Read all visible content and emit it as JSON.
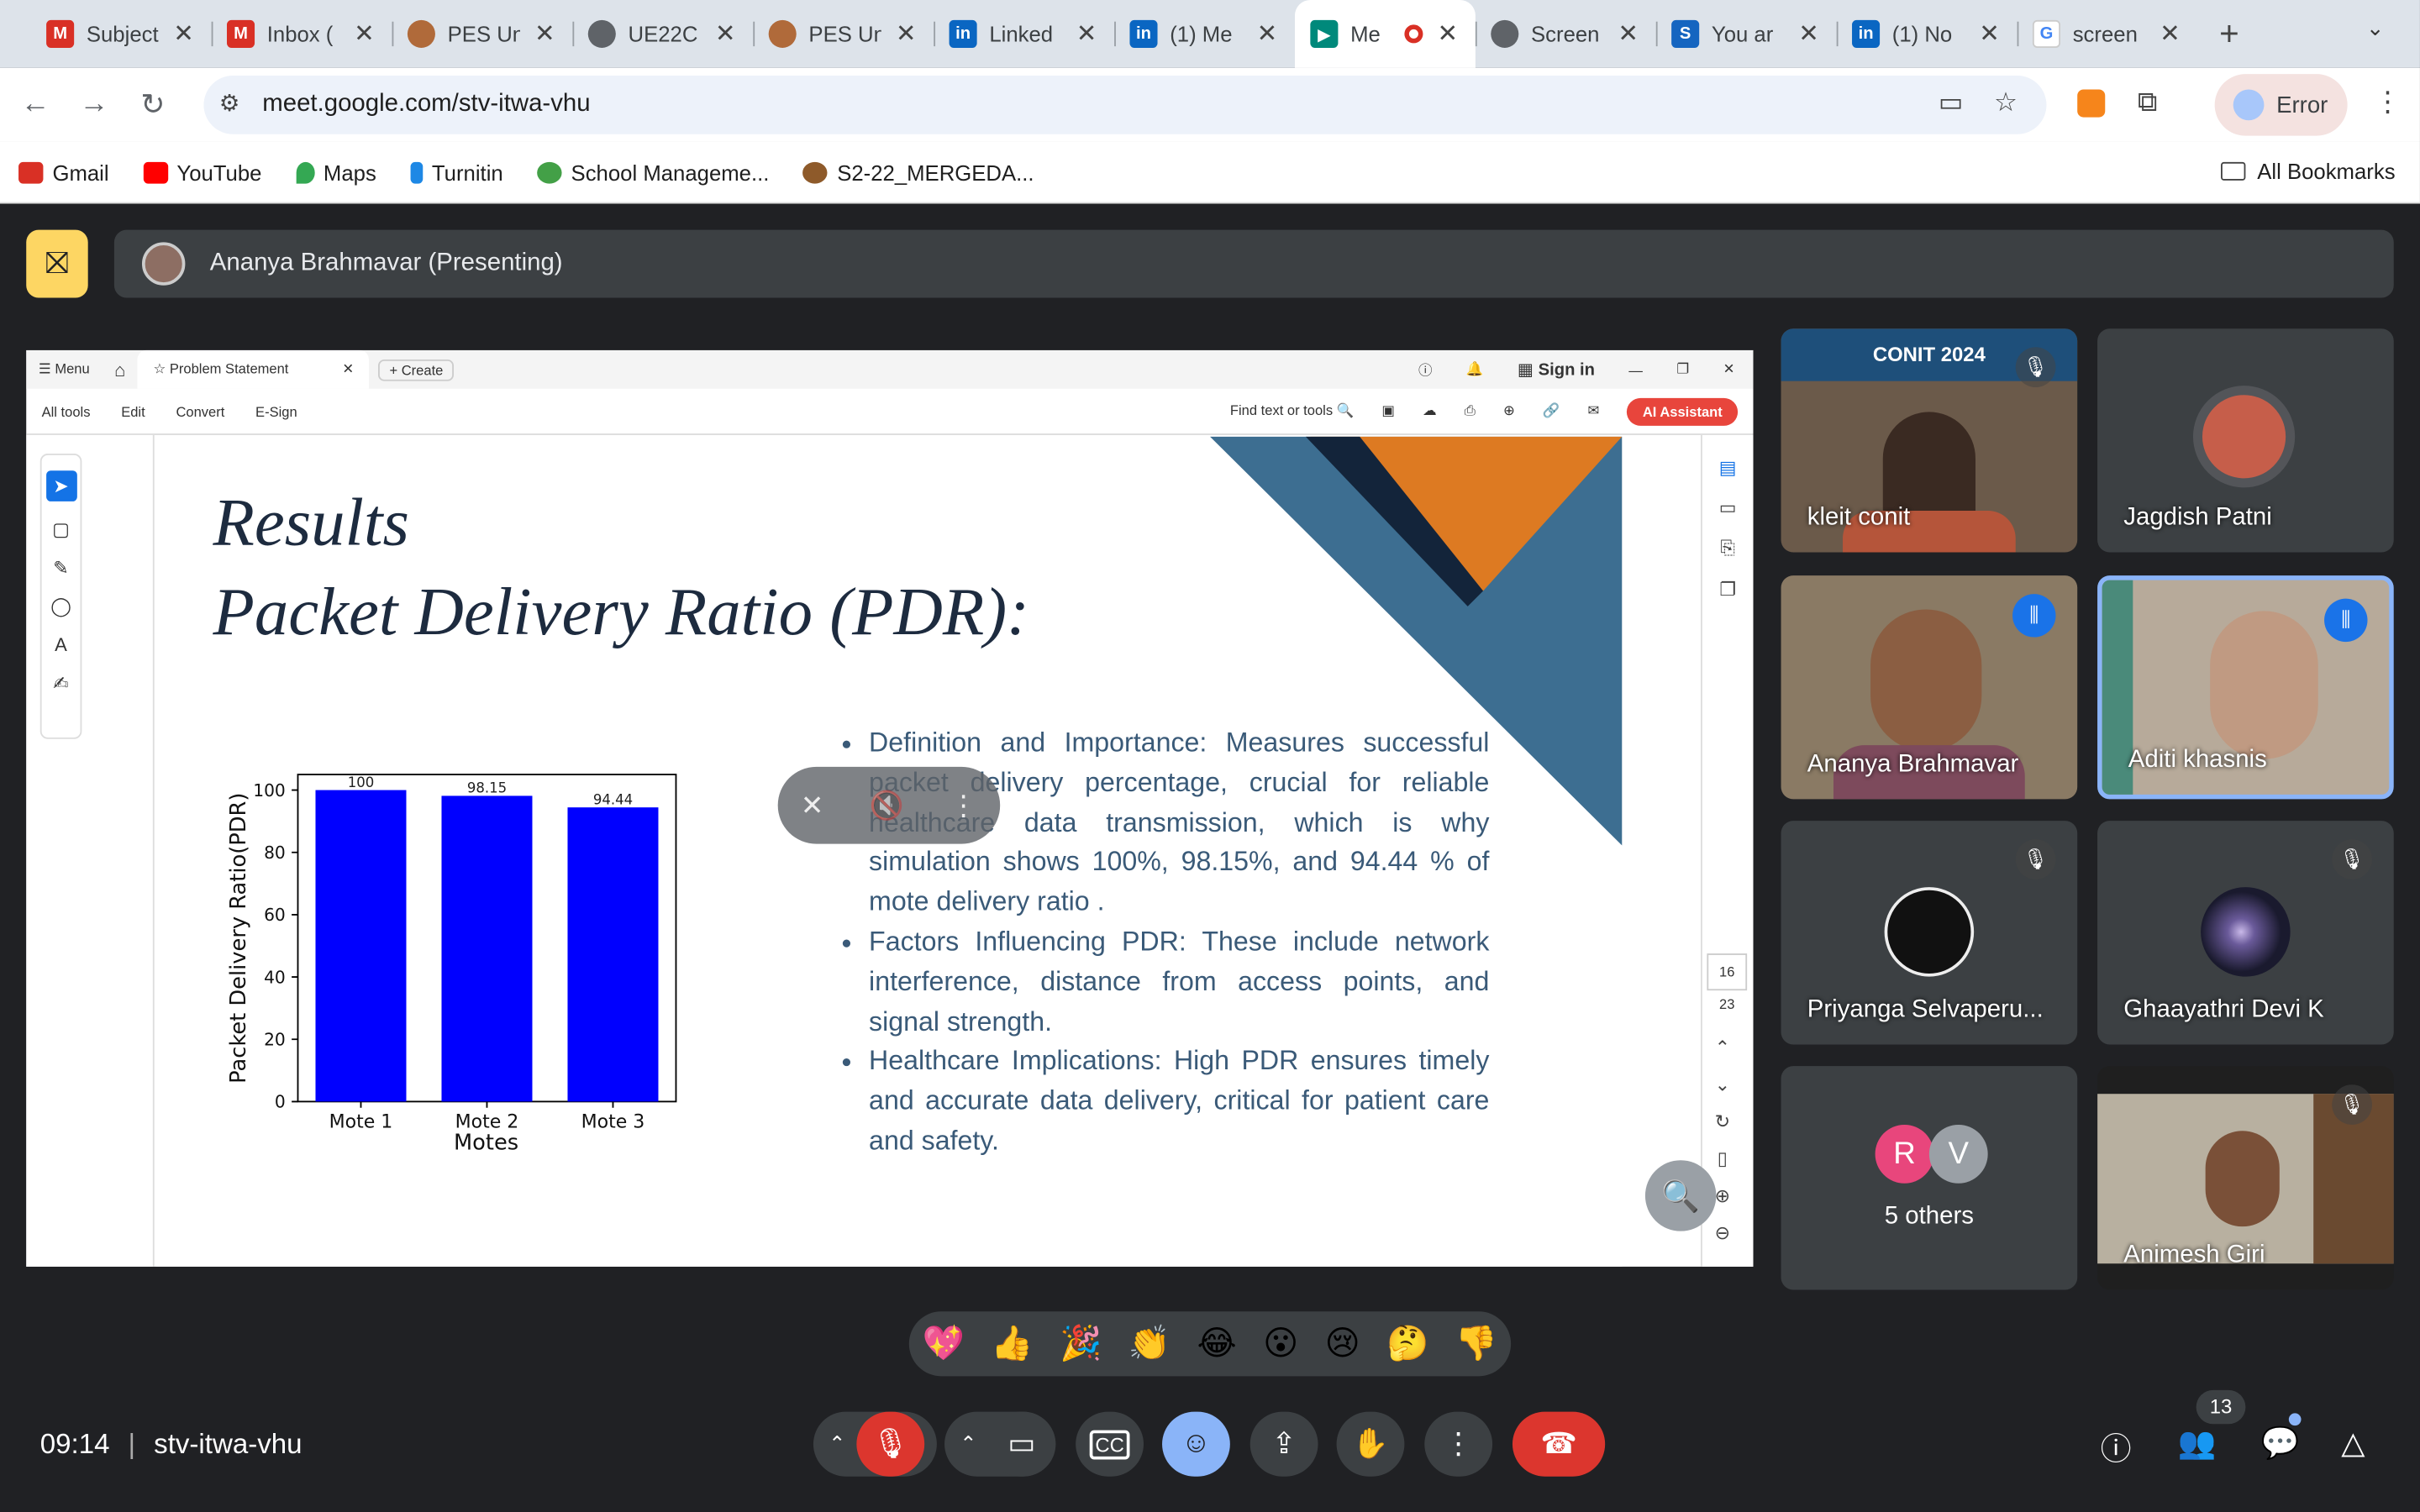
{
  "browser": {
    "tabs": [
      {
        "title": "Subject",
        "favicon": "gmail-icon",
        "color": "#d93025"
      },
      {
        "title": "Inbox (",
        "favicon": "gmail-icon",
        "color": "#d93025"
      },
      {
        "title": "PES Un",
        "favicon": "pes-icon",
        "color": "#b06a3a"
      },
      {
        "title": "UE22C",
        "favicon": "globe-icon",
        "color": "#5f6368"
      },
      {
        "title": "PES Un",
        "favicon": "pes-icon",
        "color": "#b06a3a"
      },
      {
        "title": "Linked",
        "favicon": "linkedin-icon",
        "color": "#0a66c2"
      },
      {
        "title": "(1) Me",
        "favicon": "linkedin-icon",
        "color": "#0a66c2"
      },
      {
        "title": "Me",
        "favicon": "meet-icon",
        "color": "#00897b",
        "active": true
      },
      {
        "title": "Screen",
        "favicon": "globe-icon",
        "color": "#5f6368"
      },
      {
        "title": "You ar",
        "favicon": "s-icon",
        "color": "#1565c0"
      },
      {
        "title": "(1) No",
        "favicon": "linkedin-icon",
        "color": "#0a66c2"
      },
      {
        "title": "screen",
        "favicon": "google-icon",
        "color": "#4285f4"
      }
    ],
    "url": "meet.google.com/stv-itwa-vhu",
    "profile_label": "Error",
    "bookmarks": [
      {
        "label": "Gmail",
        "color": "#d93025"
      },
      {
        "label": "YouTube",
        "color": "#ff0000"
      },
      {
        "label": "Maps",
        "color": "#34a853"
      },
      {
        "label": "Turnitin",
        "color": "#1e88e5"
      },
      {
        "label": "School Manageme...",
        "color": "#43a047"
      },
      {
        "label": "S2-22_MERGEDA...",
        "color": "#8e5a2a"
      }
    ],
    "all_bookmarks": "All Bookmarks"
  },
  "meet": {
    "presenter_label": "Ananya Brahmavar (Presenting)",
    "time": "09:14",
    "meeting_code": "stv-itwa-vhu",
    "participants_count": "13",
    "participants": [
      {
        "name": "kleit conit",
        "banner": "CONIT 2024"
      },
      {
        "name": "Jagdish Patni"
      },
      {
        "name": "Ananya Brahmavar"
      },
      {
        "name": "Aditi khasnis"
      },
      {
        "name": "Priyanga Selvaperu..."
      },
      {
        "name": "Ghaayathri Devi K"
      },
      {
        "name": "5 others",
        "initials": [
          "R",
          "V"
        ]
      },
      {
        "name": "Animesh Giri"
      }
    ],
    "reactions": [
      "💖",
      "👍",
      "🎉",
      "👏",
      "😂",
      "😮",
      "😢",
      "🤔",
      "👎"
    ]
  },
  "acrobat": {
    "menu": "Menu",
    "tab_title": "Problem Statement",
    "create": "Create",
    "sign_in": "Sign in",
    "menus": [
      "All tools",
      "Edit",
      "Convert",
      "E-Sign"
    ],
    "find": "Find text or tools",
    "ai": "AI Assistant",
    "page_current": "16",
    "page_total": "23"
  },
  "slide": {
    "title1": "Results",
    "title2": "Packet Delivery Ratio (PDR):",
    "bullets": [
      "Definition and Importance: Measures successful packet delivery percentage, crucial for reliable healthcare data transmission, which is why simulation shows 100%, 98.15%, and 94.44 % of mote delivery ratio .",
      "Factors Influencing PDR: These include network interference, distance from access points, and signal strength.",
      "Healthcare Implications: High PDR ensures timely and accurate data delivery, critical for patient care and safety."
    ]
  },
  "chart_data": {
    "type": "bar",
    "categories": [
      "Mote 1",
      "Mote 2",
      "Mote 3"
    ],
    "values": [
      100,
      98.15,
      94.44
    ],
    "data_labels": [
      "100",
      "98.15",
      "94.44"
    ],
    "xlabel": "Motes",
    "ylabel": "Packet Delivery Ratio(PDR)",
    "ylim": [
      0,
      105
    ],
    "yticks": [
      "0",
      "20",
      "40",
      "60",
      "80",
      "100"
    ],
    "bar_color": "#0000ff"
  }
}
